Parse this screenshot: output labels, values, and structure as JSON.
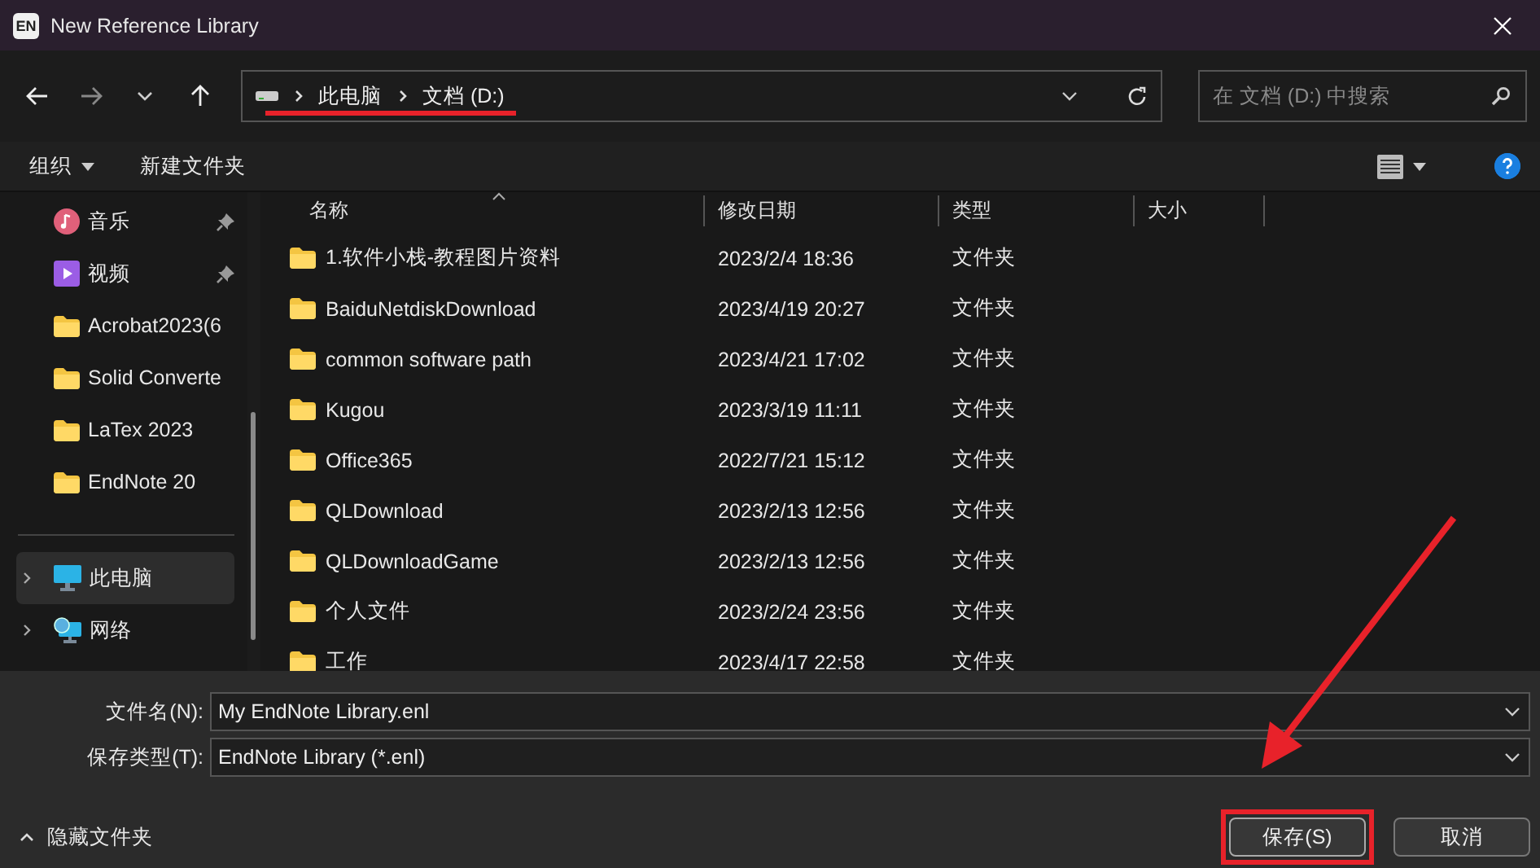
{
  "window": {
    "title": "New Reference Library",
    "logo": "EN"
  },
  "address_bar": {
    "path": [
      "此电脑",
      "文档 (D:)"
    ]
  },
  "search": {
    "placeholder": "在 文档 (D:) 中搜索"
  },
  "command_bar": {
    "organize": "组织",
    "new_folder": "新建文件夹"
  },
  "sidebar": {
    "items": [
      {
        "label": "音乐",
        "kind": "music",
        "pinned": true,
        "expandable": false,
        "selected": false
      },
      {
        "label": "视频",
        "kind": "video",
        "pinned": true,
        "expandable": false,
        "selected": false
      },
      {
        "label": "Acrobat2023(6",
        "kind": "folder",
        "pinned": false,
        "expandable": false,
        "selected": false
      },
      {
        "label": "Solid Converte",
        "kind": "folder",
        "pinned": false,
        "expandable": false,
        "selected": false
      },
      {
        "label": "LaTex 2023",
        "kind": "folder",
        "pinned": false,
        "expandable": false,
        "selected": false
      },
      {
        "label": "EndNote 20",
        "kind": "folder",
        "pinned": false,
        "expandable": false,
        "selected": false
      },
      {
        "label": "此电脑",
        "kind": "pc",
        "pinned": false,
        "expandable": true,
        "selected": true
      },
      {
        "label": "网络",
        "kind": "network",
        "pinned": false,
        "expandable": true,
        "selected": false
      }
    ]
  },
  "table": {
    "columns": [
      "名称",
      "修改日期",
      "类型",
      "大小"
    ],
    "rows": [
      [
        "1.软件小栈-教程图片资料",
        "2023/2/4 18:36",
        "文件夹"
      ],
      [
        "BaiduNetdiskDownload",
        "2023/4/19 20:27",
        "文件夹"
      ],
      [
        "common software path",
        "2023/4/21 17:02",
        "文件夹"
      ],
      [
        "Kugou",
        "2023/3/19 11:11",
        "文件夹"
      ],
      [
        "Office365",
        "2022/7/21 15:12",
        "文件夹"
      ],
      [
        "QLDownload",
        "2023/2/13 12:56",
        "文件夹"
      ],
      [
        "QLDownloadGame",
        "2023/2/13 12:56",
        "文件夹"
      ],
      [
        "个人文件",
        "2023/2/24 23:56",
        "文件夹"
      ],
      [
        "工作",
        "2023/4/17 22:58",
        "文件夹"
      ]
    ]
  },
  "file_name": {
    "label": "文件名(N):",
    "value": "My EndNote Library.enl"
  },
  "file_type": {
    "label": "保存类型(T):",
    "value": "EndNote Library (*.enl)"
  },
  "hide_folders": "隐藏文件夹",
  "buttons": [
    "保存(S)",
    "取消"
  ]
}
